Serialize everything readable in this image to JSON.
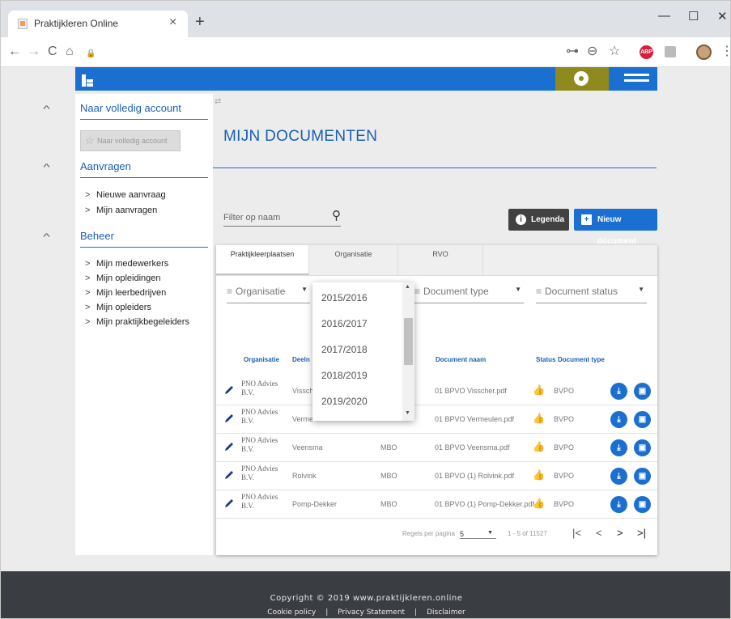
{
  "browser": {
    "tab_title": "Praktijkleren Online",
    "close_glyph": "×",
    "new_tab_glyph": "+",
    "window_controls": [
      "—",
      "☐",
      "✕"
    ],
    "nav": {
      "back": "←",
      "forward": "→",
      "reload": "C",
      "home": "⌂",
      "lock": "🔒"
    },
    "toolbar_icons": {
      "key": "⊶",
      "zoom": "⊖",
      "star": "☆",
      "adblock": "ABP",
      "menu": "⋮"
    }
  },
  "sidebar": {
    "section_account": "Naar volledig account",
    "account_button": "Naar volledig account",
    "section_requests": "Aanvragen",
    "requests": [
      "Nieuwe aanvraag",
      "Mijn aanvragen"
    ],
    "section_manage": "Beheer",
    "manage": [
      "Mijn medewerkers",
      "Mijn opleidingen",
      "Mijn leerbedrijven",
      "Mijn opleiders",
      "Mijn praktijkbegeleiders"
    ],
    "caret": "^",
    "chevron": ">"
  },
  "main": {
    "title": "MIJN DOCUMENTEN",
    "filter_placeholder": "Filter op naam",
    "legend_button": "Legenda",
    "new_document_button": "Nieuw document",
    "tabs": [
      "Praktijkleerplaatsen",
      "Organisatie",
      "RVO"
    ],
    "filters": {
      "organisatie": "Organisatie",
      "document_type": "Document type",
      "document_status": "Document status",
      "filter_icon": "≡",
      "dropdown_arrow": "▼"
    },
    "columns": {
      "organisatie": "Organisatie",
      "deelnemer": "Deeln",
      "document_naam": "Document naam",
      "status": "Status",
      "document_type": "Document type"
    },
    "rows": [
      {
        "org": "PNO Advies B.V.",
        "deelnemer": "Vissch",
        "niveau": "",
        "document": "01 BPVO Visscher.pdf",
        "type": "BVPO"
      },
      {
        "org": "PNO Advies B.V.",
        "deelnemer": "Verme",
        "niveau": "",
        "document": "01 BPVO Vermeulen.pdf",
        "type": "BVPO"
      },
      {
        "org": "PNO Advies B.V.",
        "deelnemer": "Veensma",
        "niveau": "MBO",
        "document": "01 BPVO Veensma.pdf",
        "type": "BVPO"
      },
      {
        "org": "PNO Advies B.V.",
        "deelnemer": "Rolvink",
        "niveau": "MBO",
        "document": "01 BPVO (1) Rolvink.pdf",
        "type": "BVPO"
      },
      {
        "org": "PNO Advies B.V.",
        "deelnemer": "Pomp-Dekker",
        "niveau": "MBO",
        "document": "01 BPVO (1) Pomp-Dekker.pdf",
        "type": "BVPO"
      }
    ],
    "pagination": {
      "rows_label": "Regels per pagina",
      "rows_value": "5",
      "range": "1 - 5 of 11527",
      "first": "|<",
      "prev": "<",
      "next": ">",
      "last": ">|"
    },
    "year_dropdown": [
      "2015/2016",
      "2016/2017",
      "2017/2018",
      "2018/2019",
      "2019/2020"
    ]
  },
  "footer": {
    "copyright": "Copyright © 2019 www.praktijkleren.online",
    "links": [
      "Cookie policy",
      "|",
      "Privacy Statement",
      "|",
      "Disclaimer"
    ]
  },
  "colors": {
    "primary": "#1a6fd0",
    "gear": "#8f8a1e",
    "footer": "#3a3d42"
  }
}
